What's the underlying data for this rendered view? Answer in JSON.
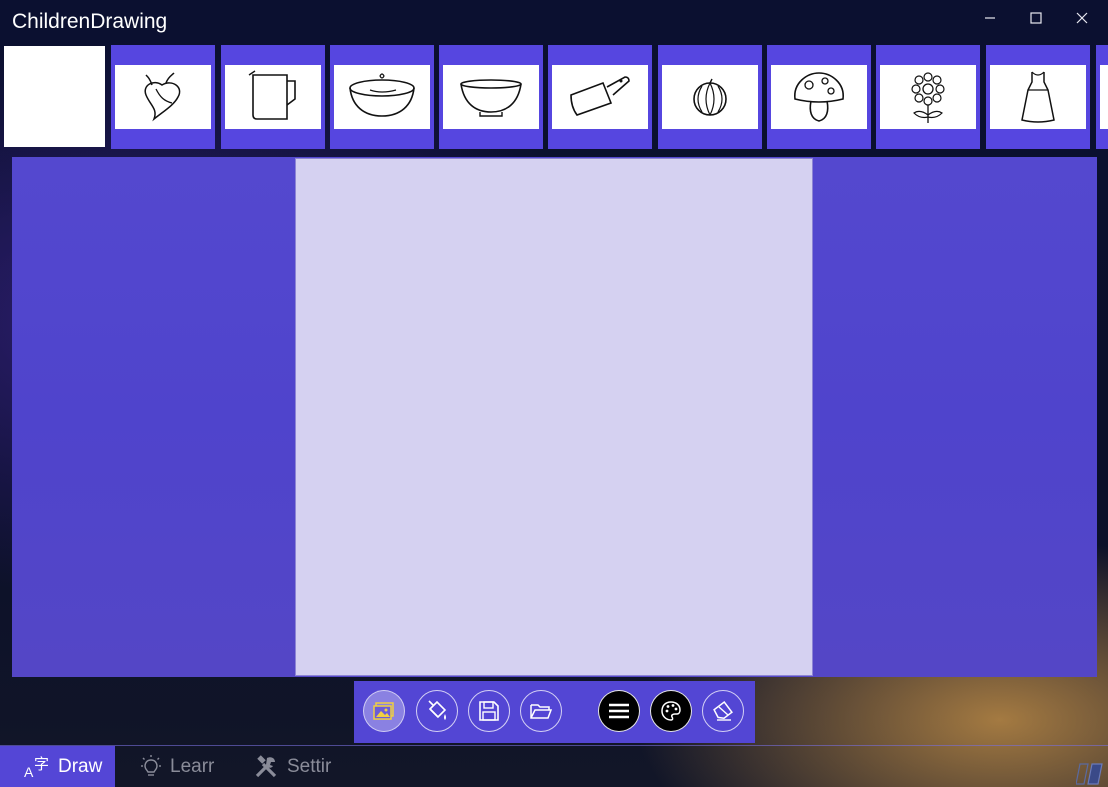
{
  "window": {
    "title": "ChildrenDrawing",
    "controls": [
      "minimize",
      "maximize",
      "close"
    ]
  },
  "templates": [
    {
      "name": "blank"
    },
    {
      "name": "chili-peppers"
    },
    {
      "name": "measuring-jug"
    },
    {
      "name": "bowl-with-liquid"
    },
    {
      "name": "bowl"
    },
    {
      "name": "cleaver"
    },
    {
      "name": "watermelon"
    },
    {
      "name": "mushroom"
    },
    {
      "name": "flower"
    },
    {
      "name": "dress"
    }
  ],
  "toolbar": {
    "tools": [
      {
        "icon": "image-icon",
        "state": "selected"
      },
      {
        "icon": "paint-bucket-icon"
      },
      {
        "icon": "save-icon"
      },
      {
        "icon": "folder-open-icon"
      },
      {
        "icon": "menu-icon"
      },
      {
        "icon": "palette-icon"
      },
      {
        "icon": "eraser-icon"
      }
    ]
  },
  "nav": {
    "tabs": [
      {
        "label": "Draw",
        "icon": "translate-icon",
        "selected": true
      },
      {
        "label": "Learr",
        "icon": "lightbulb-icon",
        "selected": false
      },
      {
        "label": "Settir",
        "icon": "tools-icon",
        "selected": false
      }
    ]
  },
  "colors": {
    "accent": "#5446d6",
    "paper": "#d5d1f1",
    "canvas_background": "#5249cd",
    "thumb_frame": "#5646e0",
    "tool_highlight": "#f0d040"
  }
}
